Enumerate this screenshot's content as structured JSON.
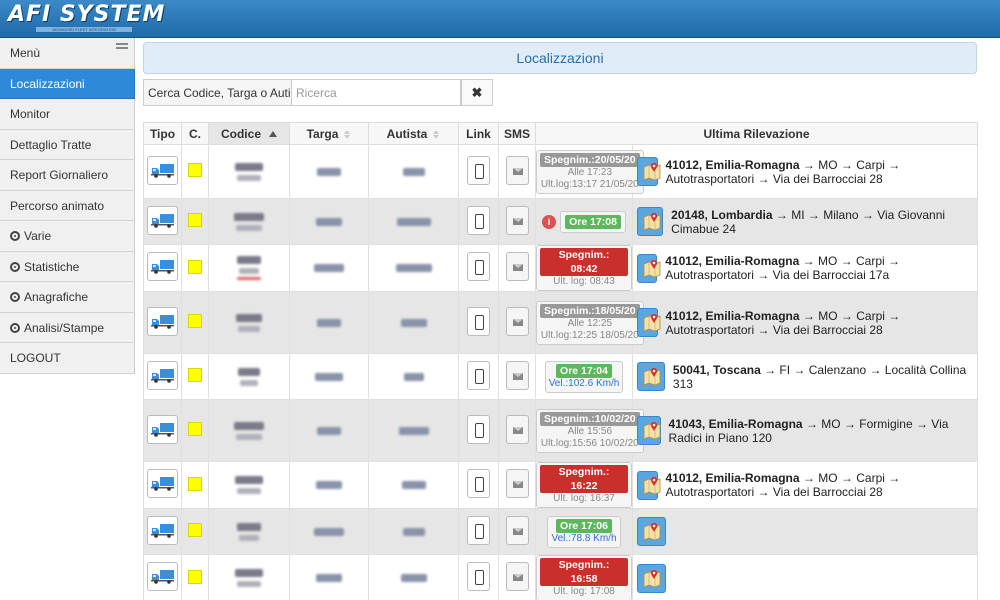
{
  "header": {
    "logo": "AFI SYSTEM",
    "logo_sub": "ADVANCED FLEET INTEGRATION"
  },
  "sidebar": {
    "items": [
      {
        "label": "Menù"
      },
      {
        "label": "Localizzazioni"
      },
      {
        "label": "Monitor"
      },
      {
        "label": "Dettaglio Tratte"
      },
      {
        "label": "Report Giornaliero"
      },
      {
        "label": "Percorso animato"
      },
      {
        "label": "Varie"
      },
      {
        "label": "Statistiche"
      },
      {
        "label": "Anagrafiche"
      },
      {
        "label": "Analisi/Stampe"
      },
      {
        "label": "LOGOUT"
      }
    ]
  },
  "main": {
    "title": "Localizzazioni",
    "search": {
      "label": "Cerca Codice, Targa o Autista:",
      "placeholder": "Ricerca",
      "value": "",
      "clear_icon": "times-icon"
    }
  },
  "table": {
    "columns": [
      "Tipo",
      "C.",
      "Codice",
      "Targa",
      "Autista",
      "Link",
      "SMS",
      "Ultima Rilevazione"
    ],
    "rows": [
      {
        "status": {
          "label": "Spegnim.:20/05/20",
          "color": "grey",
          "line1": "Alle 17:23",
          "line2": "Ult.log:13:17 21/05/20"
        },
        "location": {
          "bold": "41012, Emilia-Romagna",
          "rest": " → MO → Carpi → Autotrasportatori → Via dei Barrocciai 28"
        }
      },
      {
        "status": {
          "label": "Ore 17:08",
          "color": "green",
          "alert": "i"
        },
        "location": {
          "bold": "20148, Lombardia",
          "rest": " → MI → Milano → Via Giovanni Cimabue 24"
        }
      },
      {
        "status": {
          "label": "Spegnim.: 08:42",
          "color": "red",
          "line1": "Ult. log: 08:43"
        },
        "location": {
          "bold": "41012, Emilia-Romagna",
          "rest": " → MO → Carpi → Autotrasportatori → Via dei Barrocciai 17a"
        }
      },
      {
        "status": {
          "label": "Spegnim.:18/05/20",
          "color": "grey",
          "line1": "Alle 12:25",
          "line2": "Ult.log:12:25 18/05/20"
        },
        "location": {
          "bold": "41012, Emilia-Romagna",
          "rest": " → MO → Carpi → Autotrasportatori → Via dei Barrocciai 28"
        }
      },
      {
        "status": {
          "label": "Ore 17:04",
          "color": "green",
          "line1": "Vel.:102.6 Km/h",
          "line1_blue": true
        },
        "location": {
          "bold": "50041, Toscana",
          "rest": " → FI → Calenzano → Località Collina 313"
        }
      },
      {
        "status": {
          "label": "Spegnim.:10/02/20",
          "color": "grey",
          "line1": "Alle 15:56",
          "line2": "Ult.log:15:56 10/02/20"
        },
        "location": {
          "bold": "41043, Emilia-Romagna",
          "rest": " → MO → Formigine → Via Radici in Piano 120"
        }
      },
      {
        "status": {
          "label": "Spegnim.: 16:22",
          "color": "red",
          "line1": "Ult. log: 16:37"
        },
        "location": {
          "bold": "41012, Emilia-Romagna",
          "rest": " → MO → Carpi → Autotrasportatori → Via dei Barrocciai 28"
        }
      },
      {
        "status": {
          "label": "Ore 17:06",
          "color": "green",
          "line1": "Vel.:78.8 Km/h",
          "line1_blue": true
        },
        "location": {
          "bold": "",
          "rest": ""
        }
      },
      {
        "status": {
          "label": "Spegnim.: 16:58",
          "color": "red",
          "line1": "Ult. log: 17:08"
        },
        "location": {
          "bold": "",
          "rest": ""
        }
      }
    ]
  },
  "colors": {
    "accent": "#2e8ad8",
    "topbar": "#1f6aa8",
    "row_alt": "#e6e6e6",
    "indicator": "#ffff00"
  },
  "icons": {
    "tipo": "truck-icon",
    "link": "phone-icon",
    "sms": "envelope-icon",
    "map": "map-pin-icon",
    "menu": "hamburger-icon"
  }
}
